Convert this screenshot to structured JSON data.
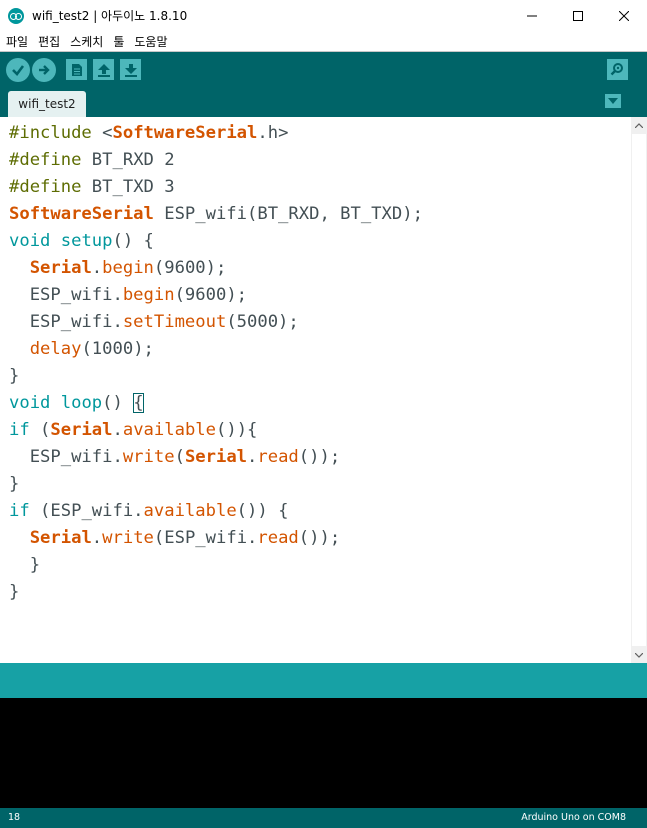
{
  "window": {
    "title": "wifi_test2 | 아두이노 1.8.10",
    "minimize": "—",
    "maximize": "☐",
    "close": "✕"
  },
  "menu": [
    "파일",
    "편집",
    "스케치",
    "툴",
    "도움말"
  ],
  "toolbar": {
    "verify_icon": "checkmark-icon",
    "upload_icon": "arrow-right-icon",
    "new_icon": "new-file-icon",
    "open_icon": "open-arrow-up-icon",
    "save_icon": "save-arrow-down-icon",
    "serial_monitor_icon": "magnifier-icon"
  },
  "tabs": [
    {
      "label": "wifi_test2"
    }
  ],
  "colors": {
    "teal_dark": "#006468",
    "teal_mid": "#17a1a5",
    "teal_light": "#4db7bb",
    "keyword_type": "#00979c",
    "keyword_function": "#d35400",
    "preprocessor": "#5e6d03",
    "text": "#434f54"
  },
  "code": [
    [
      {
        "t": "#include ",
        "c": "prep"
      },
      {
        "t": "<",
        "c": ""
      },
      {
        "t": "SoftwareSerial",
        "c": "class"
      },
      {
        "t": ".h>",
        "c": ""
      }
    ],
    [
      {
        "t": "#define ",
        "c": "prep"
      },
      {
        "t": "BT_RXD 2",
        "c": ""
      }
    ],
    [
      {
        "t": "#define ",
        "c": "prep"
      },
      {
        "t": "BT_TXD 3",
        "c": ""
      }
    ],
    [
      {
        "t": "SoftwareSerial",
        "c": "class"
      },
      {
        "t": " ESP_wifi(BT_RXD, BT_TXD);",
        "c": ""
      }
    ],
    [
      {
        "t": "void",
        "c": "type"
      },
      {
        "t": " ",
        "c": ""
      },
      {
        "t": "setup",
        "c": "type"
      },
      {
        "t": "() {",
        "c": ""
      }
    ],
    [
      {
        "t": "  ",
        "c": ""
      },
      {
        "t": "Serial",
        "c": "class"
      },
      {
        "t": ".",
        "c": ""
      },
      {
        "t": "begin",
        "c": "func"
      },
      {
        "t": "(9600);",
        "c": ""
      }
    ],
    [
      {
        "t": "  ESP_wifi.",
        "c": ""
      },
      {
        "t": "begin",
        "c": "func"
      },
      {
        "t": "(9600);",
        "c": ""
      }
    ],
    [
      {
        "t": "  ESP_wifi.",
        "c": ""
      },
      {
        "t": "setTimeout",
        "c": "func"
      },
      {
        "t": "(5000);",
        "c": ""
      }
    ],
    [
      {
        "t": "  ",
        "c": ""
      },
      {
        "t": "delay",
        "c": "func"
      },
      {
        "t": "(1000);",
        "c": ""
      }
    ],
    [
      {
        "t": "}",
        "c": ""
      }
    ],
    [
      {
        "t": "void",
        "c": "type"
      },
      {
        "t": " ",
        "c": ""
      },
      {
        "t": "loop",
        "c": "type"
      },
      {
        "t": "() ",
        "c": ""
      },
      {
        "t": "{",
        "c": "cursor"
      }
    ],
    [
      {
        "t": "if",
        "c": "type"
      },
      {
        "t": " (",
        "c": ""
      },
      {
        "t": "Serial",
        "c": "class"
      },
      {
        "t": ".",
        "c": ""
      },
      {
        "t": "available",
        "c": "func"
      },
      {
        "t": "()){",
        "c": ""
      }
    ],
    [
      {
        "t": "  ESP_wifi.",
        "c": ""
      },
      {
        "t": "write",
        "c": "func"
      },
      {
        "t": "(",
        "c": ""
      },
      {
        "t": "Serial",
        "c": "class"
      },
      {
        "t": ".",
        "c": ""
      },
      {
        "t": "read",
        "c": "func"
      },
      {
        "t": "());",
        "c": ""
      }
    ],
    [
      {
        "t": "}",
        "c": ""
      }
    ],
    [
      {
        "t": "if",
        "c": "type"
      },
      {
        "t": " (ESP_wifi.",
        "c": ""
      },
      {
        "t": "available",
        "c": "func"
      },
      {
        "t": "()) {",
        "c": ""
      }
    ],
    [
      {
        "t": "  ",
        "c": ""
      },
      {
        "t": "Serial",
        "c": "class"
      },
      {
        "t": ".",
        "c": ""
      },
      {
        "t": "write",
        "c": "func"
      },
      {
        "t": "(ESP_wifi.",
        "c": ""
      },
      {
        "t": "read",
        "c": "func"
      },
      {
        "t": "());",
        "c": ""
      }
    ],
    [
      {
        "t": "  }",
        "c": ""
      }
    ],
    [
      {
        "t": "}",
        "c": ""
      }
    ]
  ],
  "status": {
    "line_number": "18",
    "board": "Arduino Uno on COM8"
  }
}
